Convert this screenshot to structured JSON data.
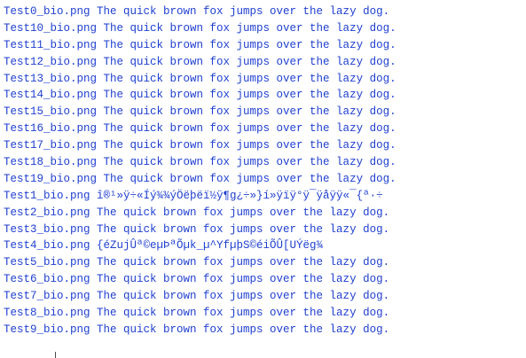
{
  "console": {
    "lines": [
      "Test0_bio.png The quick brown fox jumps over the lazy dog.",
      "Test10_bio.png The quick brown fox jumps over the lazy dog.",
      "Test11_bio.png The quick brown fox jumps over the lazy dog.",
      "Test12_bio.png The quick brown fox jumps over the lazy dog.",
      "Test13_bio.png The quick brown fox jumps over the lazy dog.",
      "Test14_bio.png The quick brown fox jumps over the lazy dog.",
      "Test15_bio.png The quick brown fox jumps over the lazy dog.",
      "Test16_bio.png The quick brown fox jumps over the lazy dog.",
      "Test17_bio.png The quick brown fox jumps over the lazy dog.",
      "Test18_bio.png The quick brown fox jumps over the lazy dog.",
      "Test19_bio.png The quick brown fox jumps over the lazy dog.",
      "Test1_bio.png î®¹»ÿ÷«Íý¾¾ýÖëþëï½ÿ¶g¿÷»}í»ÿïÿ°ÿ¯ÿåÿÿ«¯{ª·÷",
      "Test2_bio.png The quick brown fox jumps over the lazy dog.",
      "Test3_bio.png The quick brown fox jumps over the lazy dog.",
      "Test4_bio.png {éZujÛª©eµÞªÕµk_µ^YfµþS©éiÕÛ[UÝëg¾",
      "Test5_bio.png The quick brown fox jumps over the lazy dog.",
      "Test6_bio.png The quick brown fox jumps over the lazy dog.",
      "Test7_bio.png The quick brown fox jumps over the lazy dog.",
      "Test8_bio.png The quick brown fox jumps over the lazy dog.",
      "Test9_bio.png The quick brown fox jumps over the lazy dog."
    ]
  }
}
